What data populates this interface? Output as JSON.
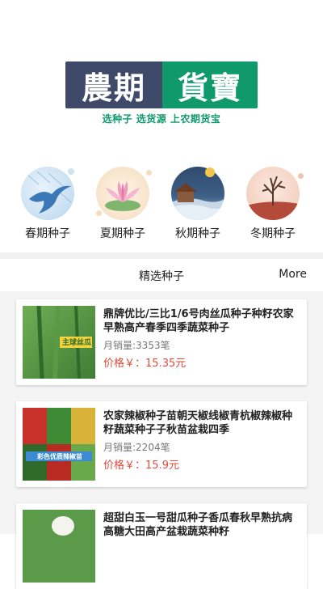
{
  "logo": {
    "left_text": "農期",
    "right_text": "貨寶"
  },
  "slogan": "选种子 选货源 上农期货宝",
  "categories": [
    {
      "label": "春期种子",
      "icon": "swallow-icon"
    },
    {
      "label": "夏期种子",
      "icon": "lotus-icon"
    },
    {
      "label": "秋期种子",
      "icon": "cabin-sunset-icon"
    },
    {
      "label": "冬期种子",
      "icon": "winter-tree-icon"
    }
  ],
  "section": {
    "title": "精选种子",
    "more": "More"
  },
  "products": [
    {
      "name": "鼎牌优比/三比1/6号肉丝瓜种子种籽农家早熟高产春季四季蔬菜种子",
      "sales": "月销量:3353笔",
      "price_label": "价格￥：",
      "price": "15.35元",
      "thumb_text": "主球丝瓜"
    },
    {
      "name": "农家辣椒种子苗朝天椒线椒青杭椒辣椒种籽蔬菜种子子秋苗盆栽四季",
      "sales": "月销量:2204笔",
      "price_label": "价格￥：",
      "price": "15.9元",
      "thumb_text": "彩色优质辣椒苗"
    },
    {
      "name": "超甜白玉一号甜瓜种子香瓜春秋早熟抗病高糖大田高产盆栽蔬菜种籽",
      "sales": "",
      "price_label": "",
      "price": "",
      "thumb_text": ""
    }
  ],
  "colors": {
    "brand_dark": "#3f4a6b",
    "brand_green": "#109a6c",
    "price": "#e04a3a"
  }
}
